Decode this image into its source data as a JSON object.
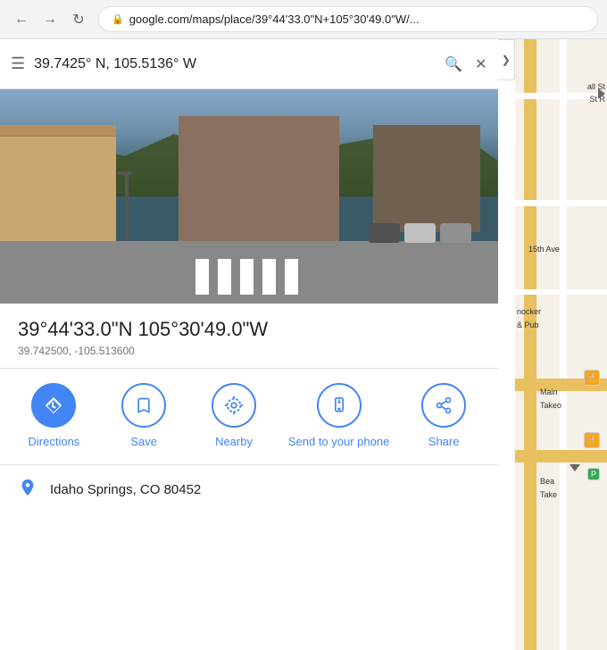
{
  "browser": {
    "url": "google.com/maps/place/39°44'33.0\"N+105°30'49.0\"W/..."
  },
  "searchbar": {
    "query": "39.7425° N, 105.5136° W",
    "hamburger_icon": "☰",
    "search_icon": "🔍",
    "close_icon": "✕",
    "collapse_icon": "❯"
  },
  "coordinates": {
    "dms": "39°44'33.0\"N 105°30'49.0\"W",
    "decimal": "39.742500, -105.513600"
  },
  "actions": [
    {
      "id": "directions",
      "label": "Directions",
      "icon": "◈",
      "filled": true
    },
    {
      "id": "save",
      "label": "Save",
      "icon": "🔖",
      "filled": false
    },
    {
      "id": "nearby",
      "label": "Nearby",
      "icon": "⊕",
      "filled": false
    },
    {
      "id": "send-to-phone",
      "label": "Send to your phone",
      "icon": "📱",
      "filled": false
    },
    {
      "id": "share",
      "label": "Share",
      "icon": "↗",
      "filled": false
    }
  ],
  "location": {
    "pin_icon": "📍",
    "text": "Idaho Springs, CO 80452"
  },
  "map": {
    "road_labels": [
      "all St",
      "St R",
      "15th Ave",
      "Main Takeo",
      "nocker & Pub",
      "Bea Take"
    ]
  }
}
